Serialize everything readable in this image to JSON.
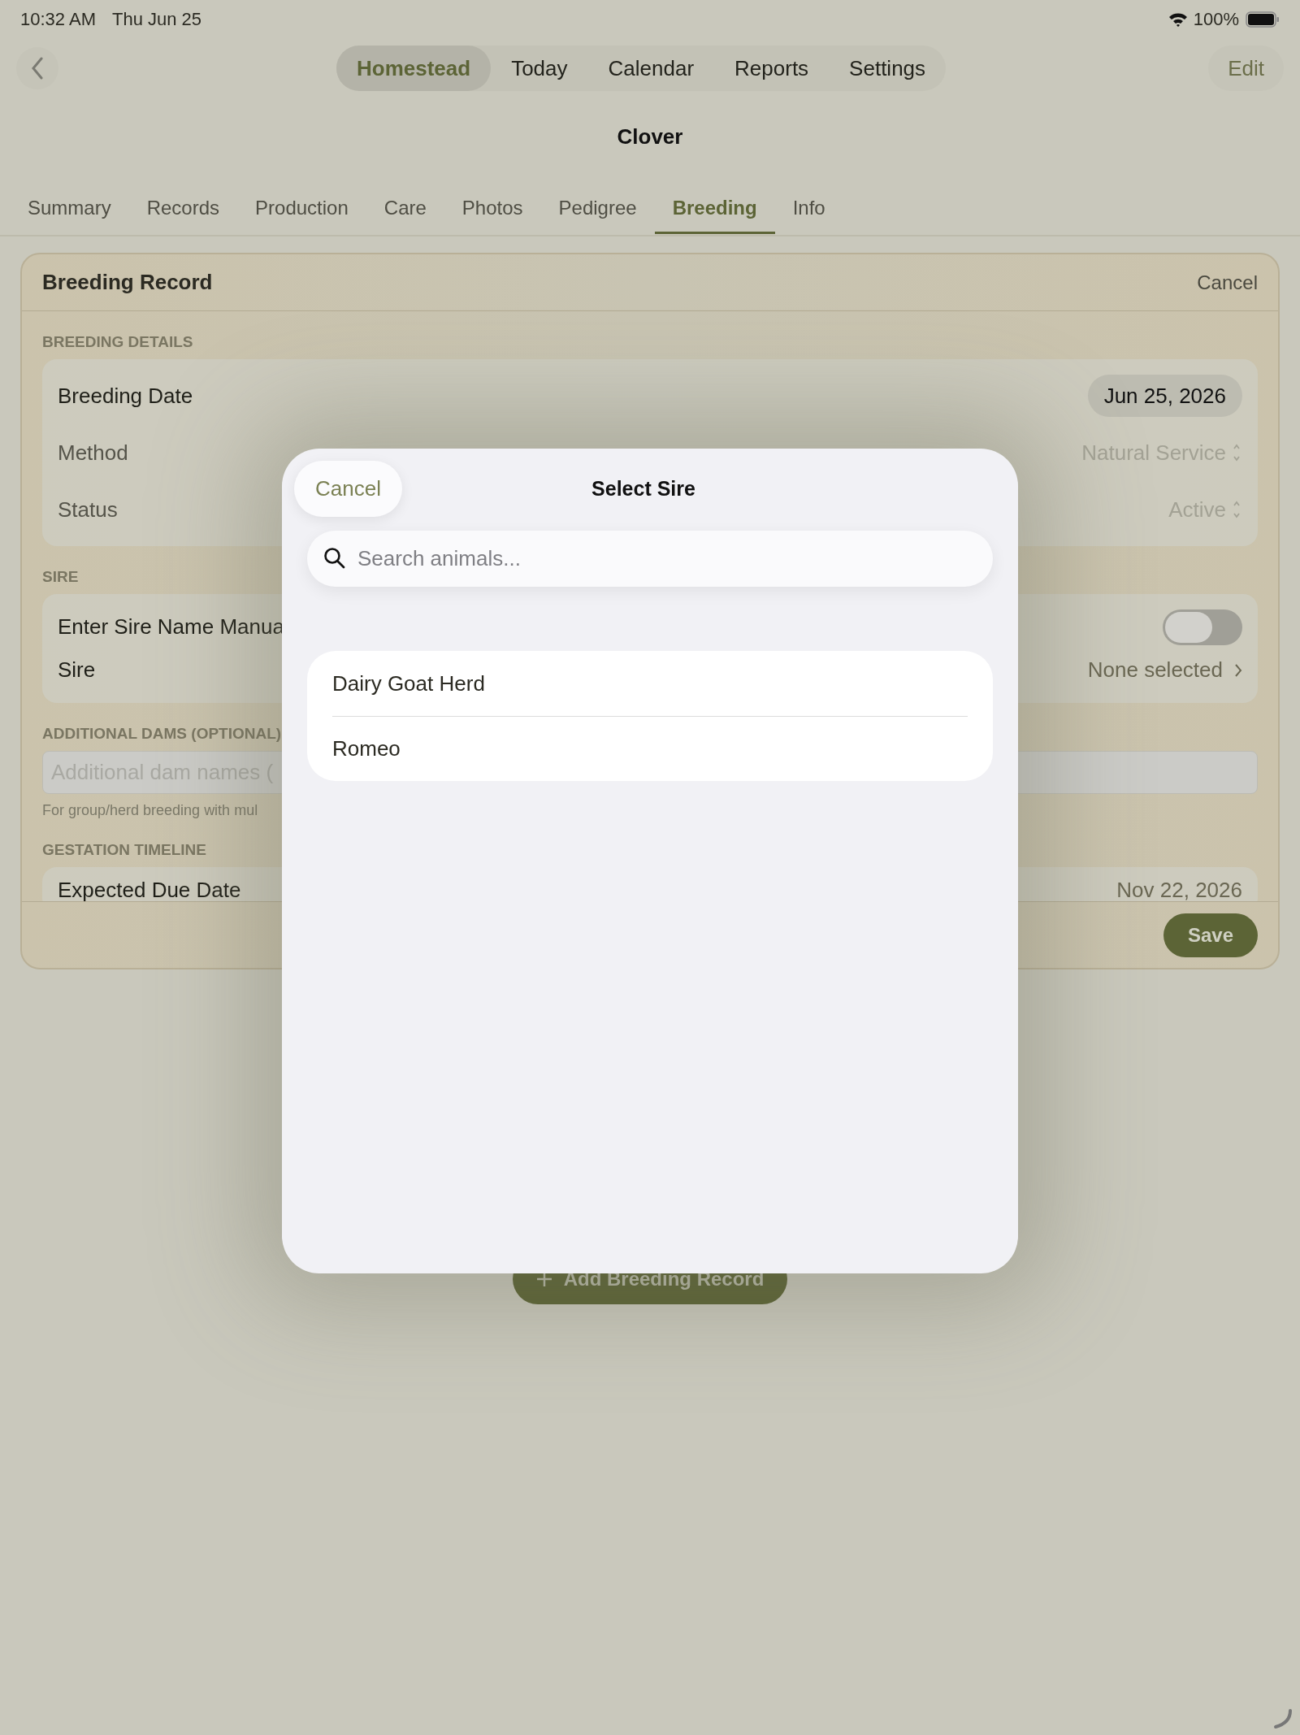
{
  "status_bar": {
    "time": "10:32 AM",
    "date": "Thu Jun 25",
    "battery": "100%"
  },
  "nav": {
    "items": [
      {
        "label": "Homestead",
        "selected": true
      },
      {
        "label": "Today",
        "selected": false
      },
      {
        "label": "Calendar",
        "selected": false
      },
      {
        "label": "Reports",
        "selected": false
      },
      {
        "label": "Settings",
        "selected": false
      }
    ],
    "edit": "Edit"
  },
  "title": "Clover",
  "tabs": [
    {
      "label": "Summary",
      "selected": false
    },
    {
      "label": "Records",
      "selected": false
    },
    {
      "label": "Production",
      "selected": false
    },
    {
      "label": "Care",
      "selected": false
    },
    {
      "label": "Photos",
      "selected": false
    },
    {
      "label": "Pedigree",
      "selected": false
    },
    {
      "label": "Breeding",
      "selected": true
    },
    {
      "label": "Info",
      "selected": false
    }
  ],
  "record": {
    "title": "Breeding Record",
    "cancel": "Cancel",
    "sections": [
      {
        "label": "BREEDING DETAILS",
        "kind": "group",
        "rows": [
          {
            "kind": "date",
            "label": "Breeding Date",
            "value": "Jun 25, 2026"
          },
          {
            "kind": "picker",
            "label": "Method",
            "value": "Natural Service"
          },
          {
            "kind": "picker",
            "label": "Status",
            "value": "Active"
          }
        ]
      },
      {
        "label": "SIRE",
        "kind": "group",
        "rows": [
          {
            "kind": "toggle",
            "label": "Enter Sire Name Manua",
            "on": false
          },
          {
            "kind": "link",
            "label": "Sire",
            "value": "None selected"
          }
        ]
      },
      {
        "label": "ADDITIONAL DAMS (OPTIONAL)",
        "kind": "field",
        "placeholder": "Additional dam names (",
        "hint": "For group/herd breeding with mul"
      },
      {
        "label": "GESTATION TIMELINE",
        "kind": "group",
        "rows": [
          {
            "kind": "text",
            "label": "Expected Due Date",
            "value": "Nov 22, 2026"
          }
        ]
      }
    ],
    "save": "Save"
  },
  "add_button": "Add Breeding Record",
  "sheet": {
    "cancel": "Cancel",
    "title": "Select Sire",
    "search": {
      "placeholder": "Search animals..."
    },
    "animals": [
      "Dairy Goat Herd",
      "Romeo"
    ]
  }
}
